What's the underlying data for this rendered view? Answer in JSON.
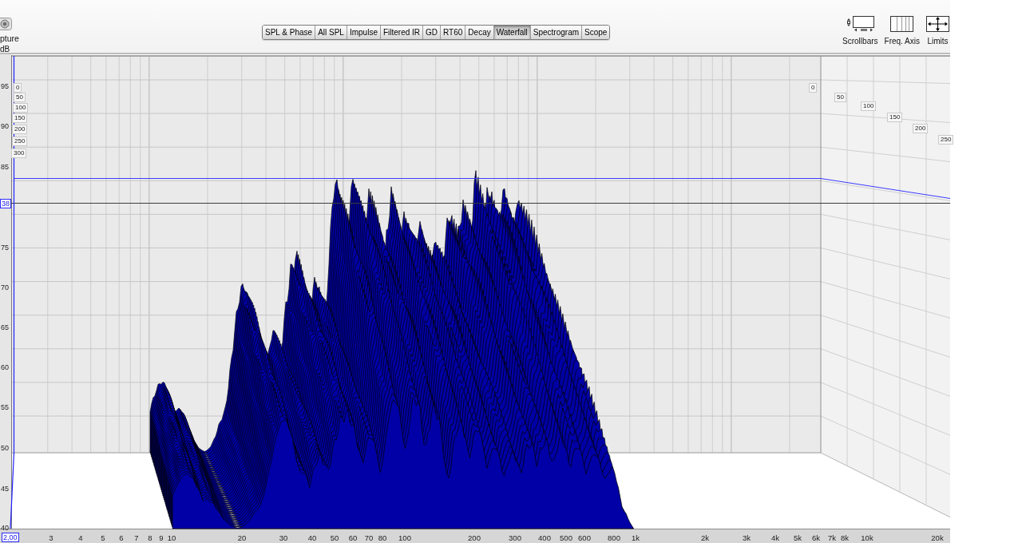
{
  "capture_button": {
    "label": "pture"
  },
  "graph_tabs": [
    {
      "label": "SPL & Phase",
      "selected": false
    },
    {
      "label": "All SPL",
      "selected": false
    },
    {
      "label": "Impulse",
      "selected": false
    },
    {
      "label": "Filtered IR",
      "selected": false
    },
    {
      "label": "GD",
      "selected": false
    },
    {
      "label": "RT60",
      "selected": false
    },
    {
      "label": "Decay",
      "selected": false
    },
    {
      "label": "Waterfall",
      "selected": true
    },
    {
      "label": "Spectrogram",
      "selected": false
    },
    {
      "label": "Scope",
      "selected": false
    }
  ],
  "tool_buttons": [
    {
      "kind": "scrollbars",
      "label": "Scrollbars"
    },
    {
      "kind": "freq_axis",
      "label": "Freq. Axis"
    },
    {
      "kind": "limits",
      "label": "Limits"
    }
  ],
  "plot": {
    "y_unit": "dB",
    "y_ticks": [
      "95",
      "90",
      "85",
      "75",
      "70",
      "65",
      "60",
      "55",
      "50",
      "45",
      "40"
    ],
    "level_readout": "38",
    "frequency_readout": "2,00",
    "x_ticks": [
      "3",
      "4",
      "5",
      "6",
      "7",
      "8",
      "9",
      "10",
      "20",
      "30",
      "40",
      "50",
      "60",
      "70",
      "80",
      "100",
      "200",
      "300",
      "400",
      "500",
      "600",
      "800",
      "1k",
      "2k",
      "3k",
      "4k",
      "5k",
      "6k",
      "7k",
      "8k",
      "10k",
      "20k"
    ],
    "time_labels_back": [
      "0",
      "50",
      "100",
      "150",
      "200",
      "250",
      "300"
    ],
    "time_labels_side": [
      "0",
      "50",
      "100",
      "150",
      "200",
      "250"
    ]
  }
}
